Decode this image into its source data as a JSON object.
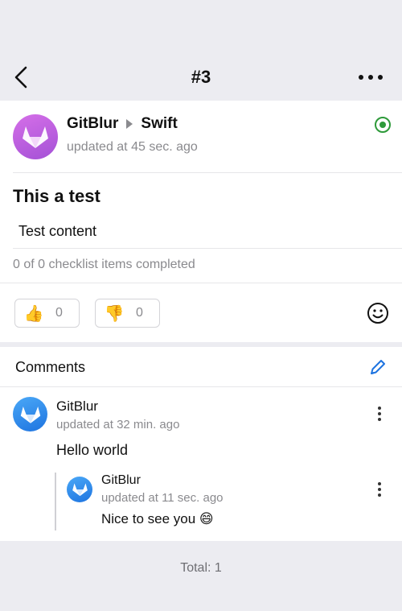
{
  "nav": {
    "title": "#3",
    "back_icon": "chevron-left-icon",
    "more_icon": "more-horizontal-icon"
  },
  "issue": {
    "owner": "GitBlur",
    "repo": "Swift",
    "updated": "updated at 45 sec. ago",
    "status": "open",
    "status_color": "#2e9a3a",
    "title": "This a test",
    "content": "Test content",
    "checklist": "0 of 0 checklist items completed",
    "reactions": [
      {
        "emoji": "👍",
        "icon": "thumbs-up-icon",
        "count": "0"
      },
      {
        "emoji": "👎",
        "icon": "thumbs-down-icon",
        "count": "0"
      }
    ]
  },
  "comments": {
    "title": "Comments",
    "items": [
      {
        "author": "GitBlur",
        "updated": "updated at 32 min. ago",
        "body": "Hello world",
        "replies": [
          {
            "author": "GitBlur",
            "updated": "updated at 11 sec. ago",
            "body": "Nice to see you 😄"
          }
        ]
      }
    ]
  },
  "footer": {
    "total": "Total: 1"
  },
  "colors": {
    "accent": "#1e74e0",
    "avatar_purple": "#c062e0",
    "avatar_blue": "#2f8cf0",
    "background": "#ececf1"
  }
}
